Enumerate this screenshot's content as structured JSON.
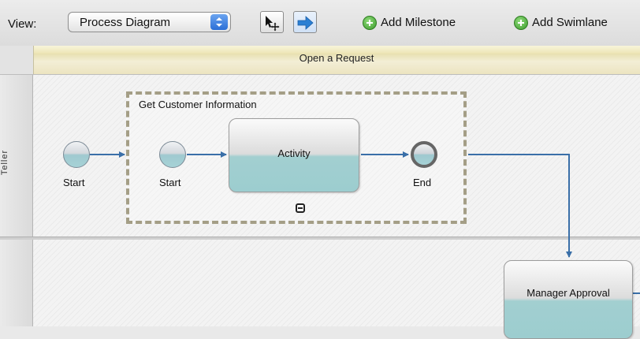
{
  "toolbar": {
    "view_label": "View:",
    "view_select": "Process Diagram",
    "add_milestone": "Add Milestone",
    "add_swimlane": "Add Swimlane"
  },
  "milestone": {
    "title": "Open a Request"
  },
  "lanes": [
    {
      "name": "Teller"
    }
  ],
  "diagram": {
    "start_event_label": "Start",
    "subprocess": {
      "title": "Get Customer Information",
      "start_label": "Start",
      "activity_label": "Activity",
      "end_label": "End"
    },
    "manager_task_label": "Manager Approval"
  },
  "icons": {
    "selection_tool": "pointer-move-icon",
    "connect_tool": "arrow-right-icon",
    "add": "green-plus-icon",
    "collapse": "minus-square-icon"
  },
  "colors": {
    "connector": "#3a6fa8",
    "task_fill": "#9ccdcf",
    "subprocess_border": "#a49e86",
    "milestone_band": "#efe7b9"
  }
}
